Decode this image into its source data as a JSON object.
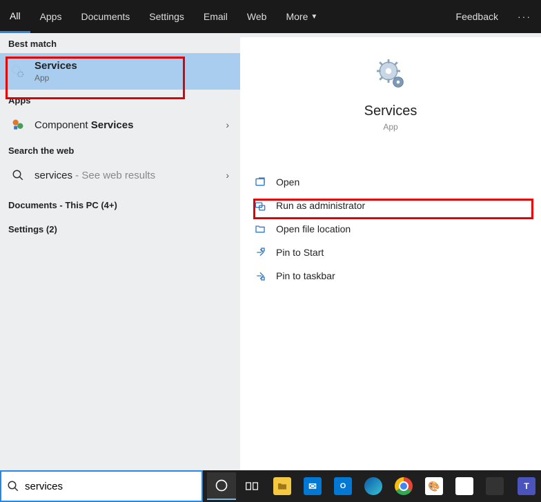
{
  "topbar": {
    "tabs": [
      {
        "label": "All",
        "active": true
      },
      {
        "label": "Apps"
      },
      {
        "label": "Documents"
      },
      {
        "label": "Settings"
      },
      {
        "label": "Email"
      },
      {
        "label": "Web"
      },
      {
        "label": "More",
        "hasDropdown": true
      }
    ],
    "feedback": "Feedback"
  },
  "left": {
    "bestMatchLabel": "Best match",
    "bestMatch": {
      "title": "Services",
      "sub": "App"
    },
    "appsLabel": "Apps",
    "appsItem": {
      "prefix": "Component ",
      "bold": "Services"
    },
    "searchWebLabel": "Search the web",
    "webItem": {
      "query": "services",
      "suffix": " - See web results"
    },
    "documentsLabel": "Documents - This PC (4+)",
    "settingsLabel": "Settings (2)"
  },
  "preview": {
    "title": "Services",
    "sub": "App",
    "actions": [
      {
        "icon": "open",
        "label": "Open"
      },
      {
        "icon": "admin",
        "label": "Run as administrator"
      },
      {
        "icon": "folder",
        "label": "Open file location"
      },
      {
        "icon": "pin",
        "label": "Pin to Start"
      },
      {
        "icon": "pin",
        "label": "Pin to taskbar"
      }
    ]
  },
  "search": {
    "value": "services"
  }
}
